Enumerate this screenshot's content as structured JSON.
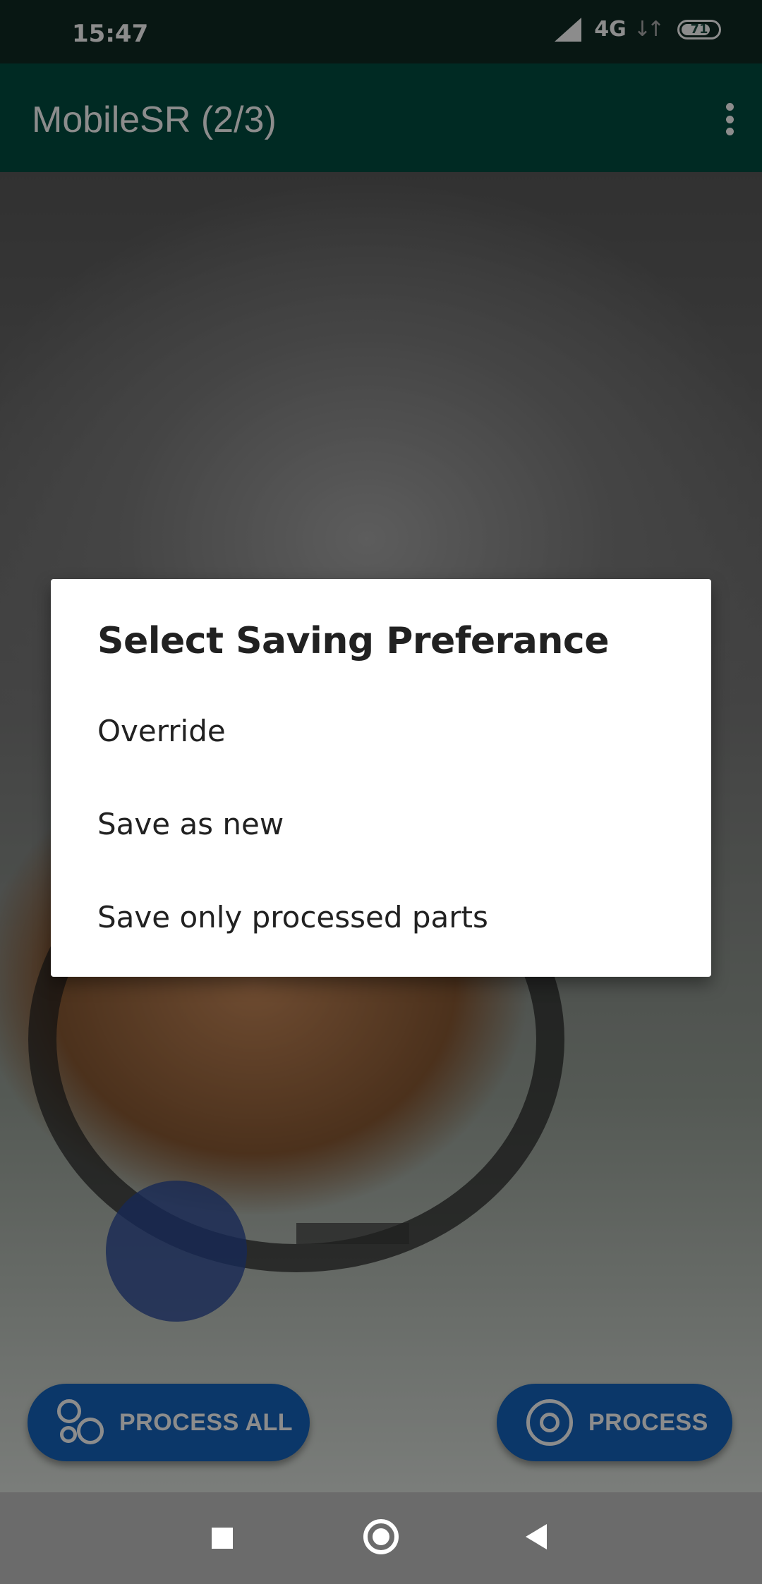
{
  "status_bar": {
    "time": "15:47",
    "network": "4G",
    "battery_level": "71",
    "icons": [
      "signal-icon",
      "data-activity-icon",
      "battery-icon"
    ]
  },
  "app_bar": {
    "title": "MobileSR (2/3)",
    "menu_icon": "more-vert-icon"
  },
  "dialog": {
    "title": "Select Saving Preferance",
    "options": [
      {
        "label": "Override"
      },
      {
        "label": "Save as new"
      },
      {
        "label": "Save only processed parts"
      }
    ]
  },
  "actions": {
    "process_all_label": "PROCESS ALL",
    "process_all_icon": "gears-icon",
    "process_label": "PROCESS",
    "process_icon": "gear-sync-icon"
  },
  "nav_bar": {
    "icons": [
      "recents-icon",
      "home-icon",
      "back-icon"
    ]
  },
  "colors": {
    "status_bar": "#0f2a24",
    "app_bar": "#004d40",
    "fab": "#1565c0",
    "dialog_bg": "#ffffff",
    "nav_bar": "#6b6b6b"
  }
}
